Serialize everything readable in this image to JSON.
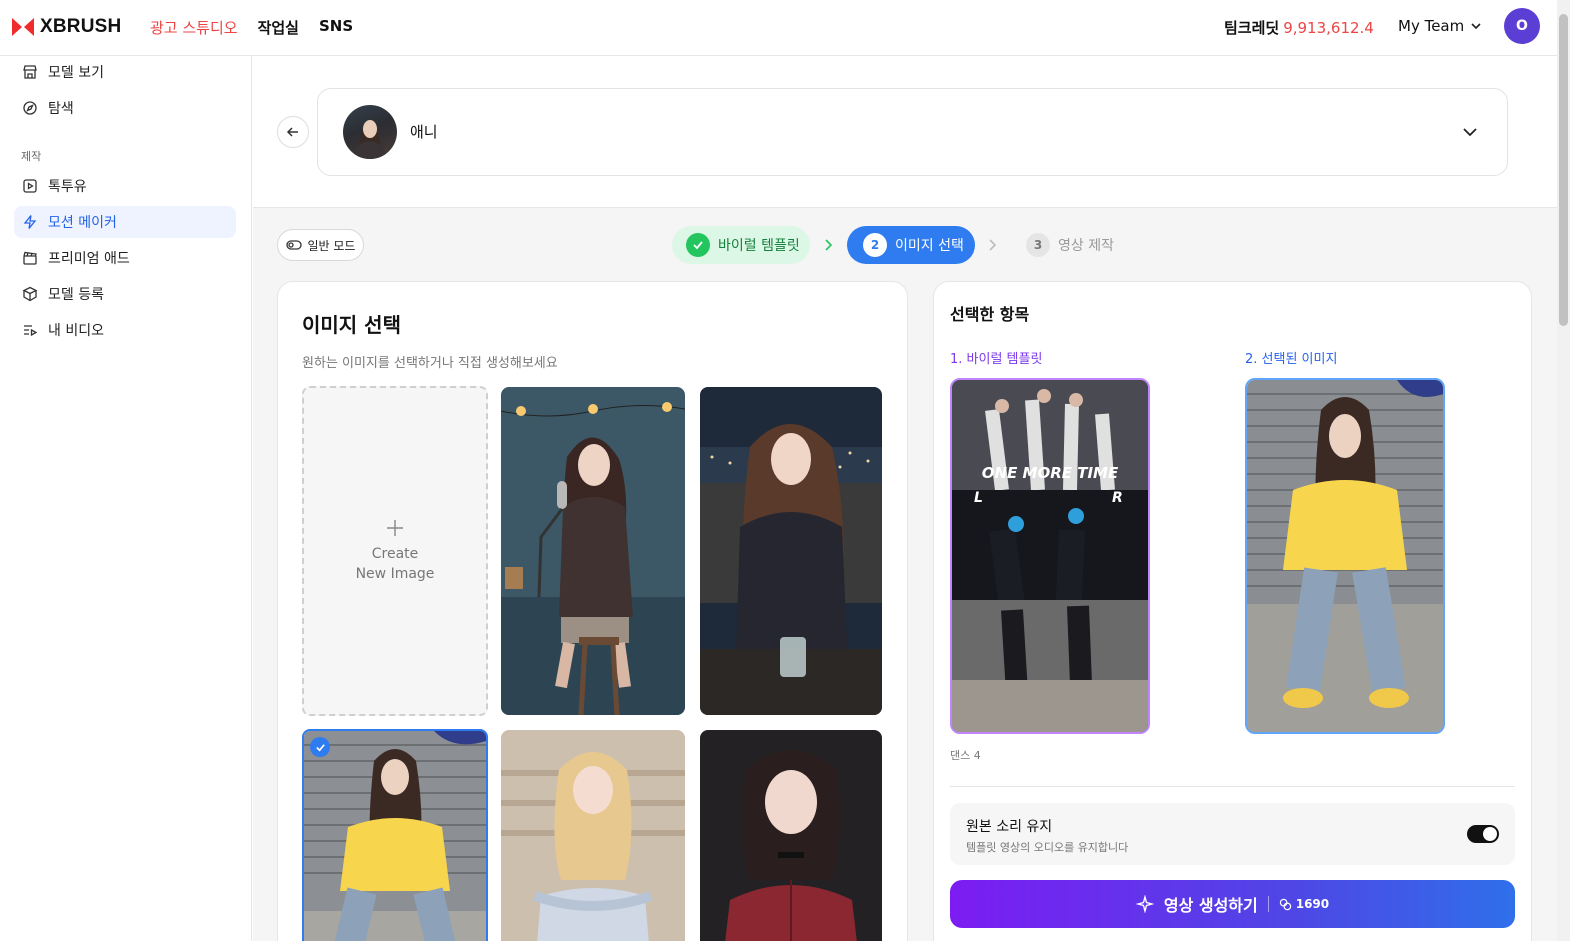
{
  "brand": {
    "name": "XBRUSH"
  },
  "topnav": [
    "광고 스튜디오",
    "작업실",
    "SNS"
  ],
  "credit": {
    "label": "팀크레딧",
    "value": "9,913,612.4"
  },
  "team": {
    "label": "My Team"
  },
  "user": {
    "initial": "O"
  },
  "sidebar": {
    "items": [
      {
        "label": "모델 보기",
        "icon": "store-icon"
      },
      {
        "label": "탐색",
        "icon": "compass-icon"
      }
    ],
    "section_label": "제작",
    "create_items": [
      {
        "label": "톡투유",
        "icon": "play-square-icon"
      },
      {
        "label": "모션 메이커",
        "icon": "lightning-icon",
        "active": true
      },
      {
        "label": "프리미엄 애드",
        "icon": "clapperboard-icon"
      },
      {
        "label": "모델 등록",
        "icon": "box-icon"
      },
      {
        "label": "내 비디오",
        "icon": "video-list-icon"
      }
    ]
  },
  "model": {
    "name": "애니"
  },
  "mode": {
    "label": "일반 모드"
  },
  "steps": [
    {
      "num": "1",
      "label": "바이럴 템플릿",
      "state": "done"
    },
    {
      "num": "2",
      "label": "이미지 선택",
      "state": "current"
    },
    {
      "num": "3",
      "label": "영상 제작",
      "state": "pending"
    }
  ],
  "image_select": {
    "title": "이미지 선택",
    "subtitle": "원하는 이미지를 선택하거나 직접 생성해보세요",
    "create_line1": "Create",
    "create_line2": "New Image",
    "images": [
      {
        "desc": "podcast-studio",
        "selected": false
      },
      {
        "desc": "night-rooftop",
        "selected": false
      },
      {
        "desc": "yellow-tshirt",
        "selected": true
      },
      {
        "desc": "blonde-dress",
        "selected": false
      },
      {
        "desc": "red-jacket-portrait",
        "selected": false
      }
    ]
  },
  "selected": {
    "title": "선택한 항목",
    "col1": "1. 바이럴 템플릿",
    "col2": "2. 선택된 이미지",
    "template_text": "ONE MORE TIME",
    "template_l": "L",
    "template_r": "R",
    "caption": "댄스 4",
    "sound_title": "원본 소리 유지",
    "sound_desc": "템플릿 영상의 오디오를 유지합니다",
    "sound_on": true,
    "generate_label": "영상 생성하기",
    "generate_cost": "1690"
  },
  "colors": {
    "accent_red": "#ef4444",
    "accent_blue": "#2e7cf0",
    "step_done_bg": "#dcf7e6",
    "purple": "#7c3aed"
  }
}
